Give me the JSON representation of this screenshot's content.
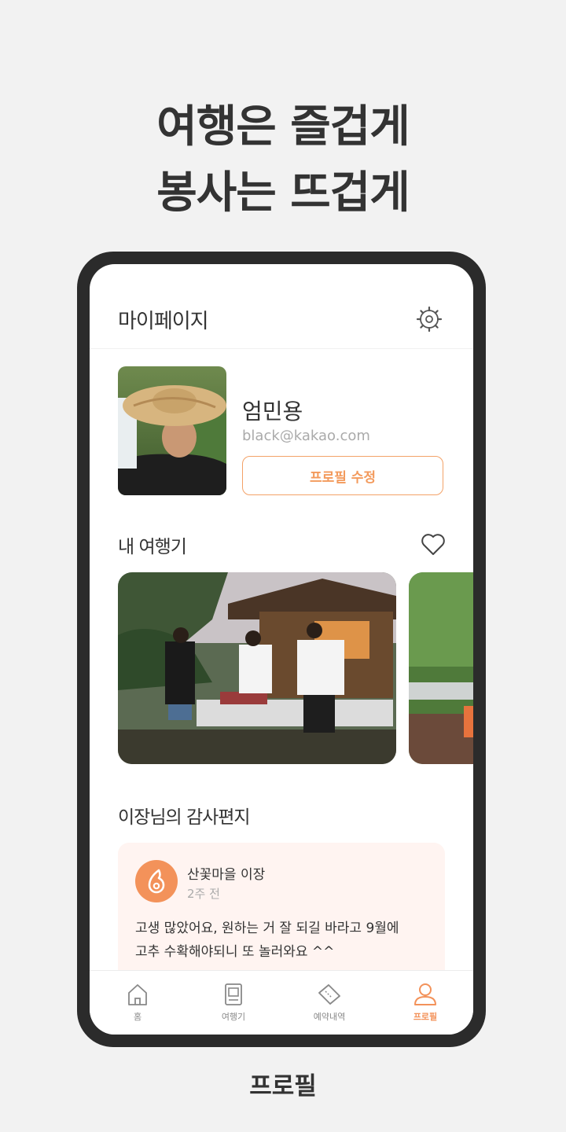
{
  "promo": {
    "headline_line1": "여행은 즐겁게",
    "headline_line2": "봉사는 뜨겁게",
    "caption": "프로필"
  },
  "appbar": {
    "title": "마이페이지",
    "settings_icon": "gear-icon"
  },
  "profile": {
    "name": "엄민용",
    "email": "black@kakao.com",
    "edit_button_label": "프로필 수정"
  },
  "journal": {
    "title": "내 여행기",
    "favorite_icon": "heart-icon"
  },
  "letters": {
    "title": "이장님의 감사편지",
    "from": "산꽃마을 이장",
    "time": "2주 전",
    "body_line1": "고생 많았어요, 원하는 거 잘 되길 바라고 9월에",
    "body_line2": "고추 수확해야되니 또 놀러와요 ^^"
  },
  "tabbar": {
    "items": [
      {
        "label": "홈",
        "icon": "home-icon"
      },
      {
        "label": "여행기",
        "icon": "book-icon"
      },
      {
        "label": "예약내역",
        "icon": "ticket-icon"
      },
      {
        "label": "프로필",
        "icon": "person-icon",
        "active": true
      }
    ]
  },
  "colors": {
    "accent": "#f3925a",
    "letter_bg": "#fff4f1",
    "phone_frame": "#2b2b2b",
    "page_bg": "#f2f2f2"
  }
}
